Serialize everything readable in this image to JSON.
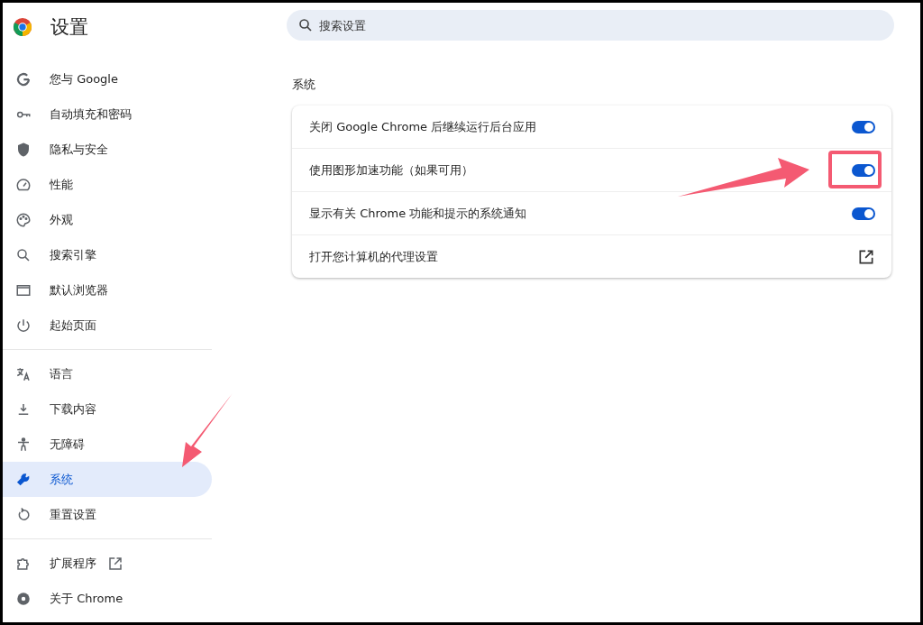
{
  "header": {
    "title": "设置"
  },
  "search": {
    "placeholder": "搜索设置"
  },
  "sidebar": {
    "groups": [
      {
        "items": [
          {
            "label": "您与 Google",
            "selected": false,
            "external": false
          },
          {
            "label": "自动填充和密码",
            "selected": false,
            "external": false
          },
          {
            "label": "隐私与安全",
            "selected": false,
            "external": false
          },
          {
            "label": "性能",
            "selected": false,
            "external": false
          },
          {
            "label": "外观",
            "selected": false,
            "external": false
          },
          {
            "label": "搜索引擎",
            "selected": false,
            "external": false
          },
          {
            "label": "默认浏览器",
            "selected": false,
            "external": false
          },
          {
            "label": "起始页面",
            "selected": false,
            "external": false
          }
        ]
      },
      {
        "items": [
          {
            "label": "语言",
            "selected": false,
            "external": false
          },
          {
            "label": "下载内容",
            "selected": false,
            "external": false
          },
          {
            "label": "无障碍",
            "selected": false,
            "external": false
          },
          {
            "label": "系统",
            "selected": true,
            "external": false
          },
          {
            "label": "重置设置",
            "selected": false,
            "external": false
          }
        ]
      },
      {
        "items": [
          {
            "label": "扩展程序",
            "selected": false,
            "external": true
          },
          {
            "label": "关于 Chrome",
            "selected": false,
            "external": false
          }
        ]
      }
    ]
  },
  "section": {
    "title": "系统",
    "rows": [
      {
        "kind": "toggle",
        "label": "关闭 Google Chrome 后继续运行后台应用",
        "on": true
      },
      {
        "kind": "toggle",
        "label": "使用图形加速功能（如果可用）",
        "on": true
      },
      {
        "kind": "toggle",
        "label": "显示有关 Chrome 功能和提示的系统通知",
        "on": true
      },
      {
        "kind": "link",
        "label": "打开您计算机的代理设置"
      }
    ]
  }
}
